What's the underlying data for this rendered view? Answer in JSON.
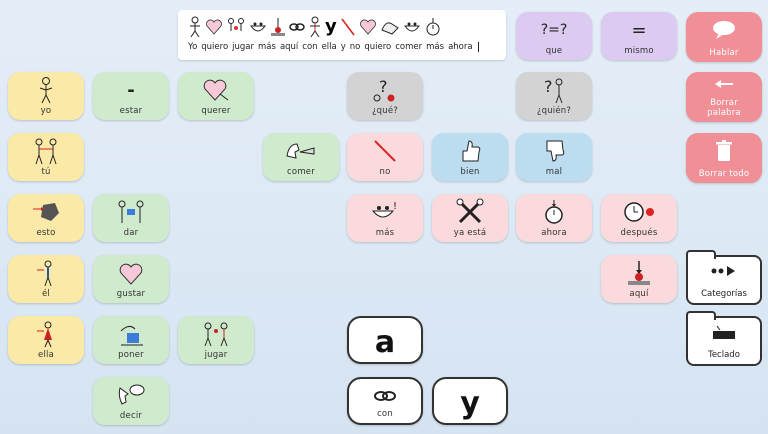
{
  "sentence": {
    "words": [
      "Yo",
      "quiero",
      "jugar",
      "más",
      "aquí",
      "con",
      "ella",
      "y",
      "no",
      "quiero",
      "comer",
      "más",
      "ahora"
    ]
  },
  "top": {
    "que": "que",
    "mismo": "mismo",
    "hablar": "Hablar"
  },
  "actions": {
    "borrar_palabra": "Borrar palabra",
    "borrar_todo": "Borrar todo"
  },
  "tiles": {
    "yo": "yo",
    "tu": "tú",
    "esto": "esto",
    "el": "él",
    "ella": "ella",
    "estar": "estar",
    "dar": "dar",
    "gustar": "gustar",
    "poner": "poner",
    "decir": "decir",
    "querer": "querer",
    "jugar": "jugar",
    "comer": "comer",
    "que_q": "¿qué?",
    "quien_q": "¿quién?",
    "no": "no",
    "bien": "bien",
    "mal": "mal",
    "mas": "más",
    "ya_esta": "ya está",
    "ahora": "ahora",
    "despues": "después",
    "aqui": "aquí",
    "con": "con"
  },
  "letters": {
    "a": "a",
    "y": "y"
  },
  "folders": {
    "categorias": "Categorías",
    "teclado": "Teclado"
  },
  "colors": {
    "person": "#fbe9a8",
    "verb": "#cfeacc",
    "question": "#d3d3d3",
    "misc": "#fadadd",
    "adjective": "#bcdcf0",
    "comparison": "#dccaf0",
    "action": "#f08f96"
  }
}
